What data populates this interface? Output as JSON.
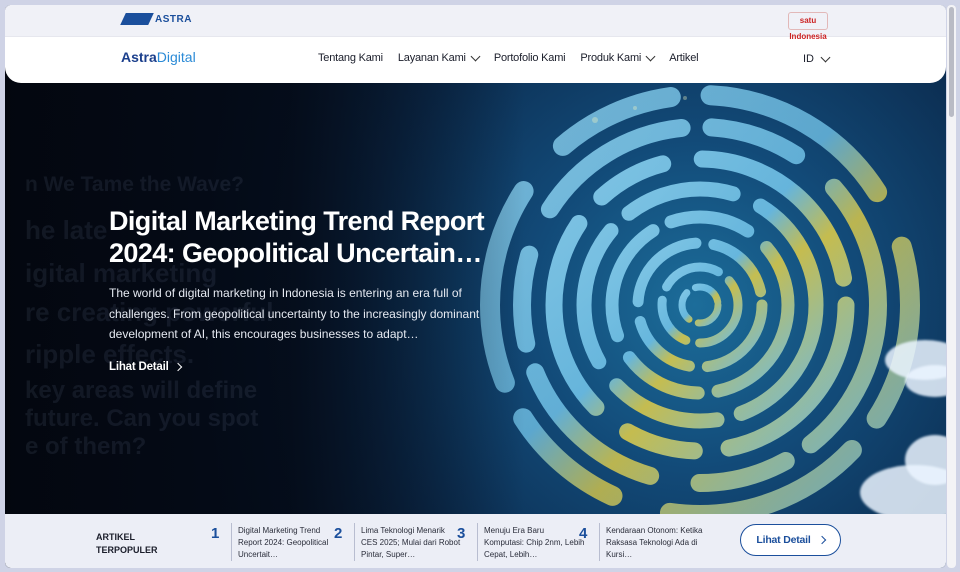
{
  "topstrip": {
    "astra_label": "ASTRA",
    "satu_label": "satu Indonesia"
  },
  "brand": {
    "name_main": "Astra",
    "name_sub": "Digital"
  },
  "nav": {
    "items": [
      {
        "label": "Tentang Kami",
        "dropdown": false
      },
      {
        "label": "Layanan Kami",
        "dropdown": true
      },
      {
        "label": "Portofolio Kami",
        "dropdown": false
      },
      {
        "label": "Produk Kami",
        "dropdown": true
      },
      {
        "label": "Artikel",
        "dropdown": false
      }
    ],
    "language": "ID"
  },
  "hero": {
    "title": "Digital Marketing Trend Report 2024: Geopolitical Uncertain…",
    "description": "The world of digital marketing in Indonesia is entering an era full of challenges. From geopolitical uncertainty to the increasingly dominant development of AI, this encourages businesses to adapt…",
    "link_label": "Lihat Detail",
    "background_text": [
      "n We Tame the Wave?",
      "he late",
      "igital marketing",
      "re creating powerful",
      "ripple effects.",
      "key areas will define",
      "future. Can you spot",
      "e of them?"
    ]
  },
  "popular": {
    "label_line1": "ARTIKEL",
    "label_line2": "TERPOPULER",
    "articles": [
      {
        "num": "1",
        "title": "Digital Marketing Trend Report 2024: Geopolitical Uncertait…"
      },
      {
        "num": "2",
        "title": "Lima Teknologi Menarik CES 2025; Mulai dari Robot Pintar, Super…"
      },
      {
        "num": "3",
        "title": "Menuju Era Baru Komputasi: Chip 2nm, Lebih Cepat, Lebih…"
      },
      {
        "num": "4",
        "title": "Kendaraan Otonom: Ketika Raksasa Teknologi Ada di Kursi…"
      }
    ],
    "detail_button": "Lihat Detail"
  },
  "colors": {
    "brand_blue": "#1b4f9c",
    "accent_light_blue": "#2a8ad6",
    "hero_bg": "#0b1830"
  }
}
